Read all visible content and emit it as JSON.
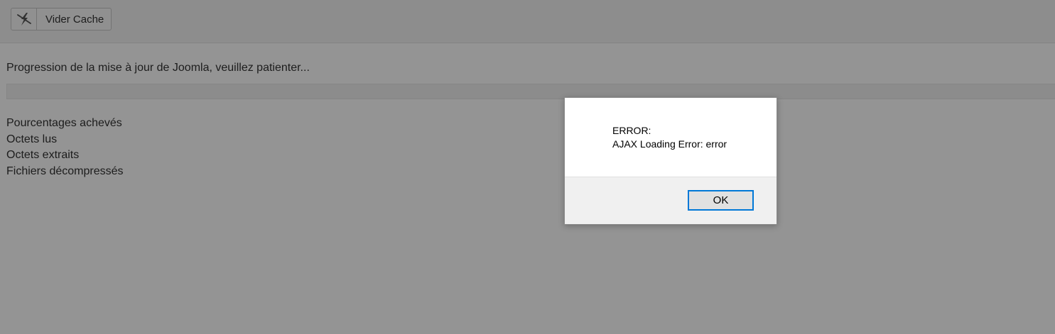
{
  "toolbar": {
    "clear_cache_label": "Vider Cache",
    "clear_cache_icon": "lightning-icon"
  },
  "main": {
    "progress_title": "Progression de la mise à jour de Joomla, veuillez patienter...",
    "progress_value": 0,
    "stats": {
      "percent_complete": "Pourcentages achevés",
      "bytes_read": "Octets lus",
      "bytes_extracted": "Octets extraits",
      "files_unzipped": "Fichiers décompressés"
    }
  },
  "dialog": {
    "line1": "ERROR:",
    "line2": "AJAX Loading Error: error",
    "ok_label": "OK"
  },
  "colors": {
    "dialog_focus": "#0078d7",
    "overlay": "rgba(0,0,0,0.42)"
  }
}
